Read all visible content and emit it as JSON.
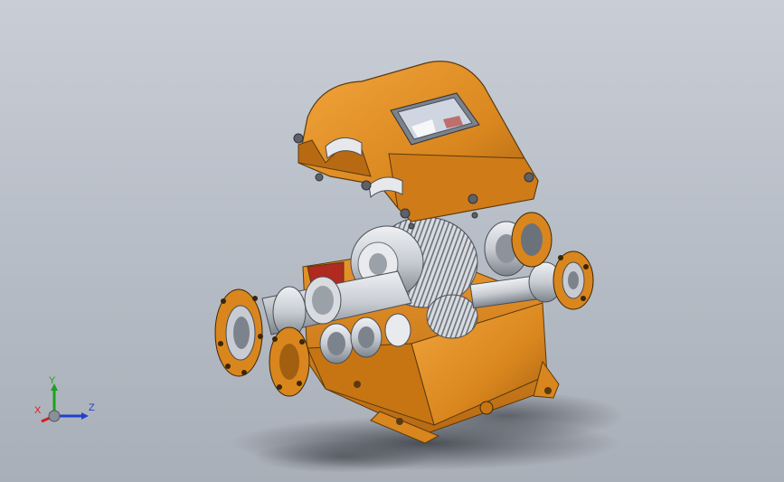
{
  "viewport": {
    "background_top": "#c9ced6",
    "background_bottom": "#a9afb8"
  },
  "model": {
    "housing_color": "#d9861e",
    "housing_shadow": "#a35f10",
    "housing_highlight": "#f0a23a",
    "metal_color": "#c8ccd2",
    "metal_dark": "#7d838c",
    "ground_shadow": "#4c5058",
    "gear_teeth_color": "#9aa0a8",
    "sight_glass_color": "#cfd6e2"
  },
  "triad": {
    "x_label": "X",
    "y_label": "Y",
    "z_label": "Z",
    "x_color": "#d02020",
    "y_color": "#20a020",
    "z_color": "#2040d0"
  }
}
